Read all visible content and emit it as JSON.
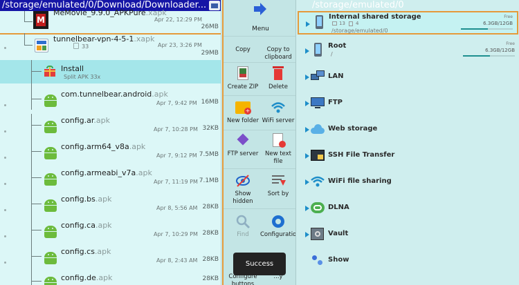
{
  "left": {
    "path": "/storage/emulated/0/Download/Downloader...",
    "top_item": {
      "name": "MeMovie_9.9.0_APKPure",
      "ext": ".xapk",
      "date": "Apr 22, 12:29 PM",
      "size": "26MB"
    },
    "folder": {
      "name": "tunnelbear-vpn-4-5-1",
      "ext": ".xapk",
      "count": "33",
      "date": "Apr 23, 3:26 PM",
      "size": "29MB"
    },
    "install": {
      "name": "Install",
      "sub": "Split APK 33x"
    },
    "files": [
      {
        "name": "com.tunnelbear.android",
        "ext": ".apk",
        "date": "Apr 7, 9:42 PM",
        "size": "16MB"
      },
      {
        "name": "config.ar",
        "ext": ".apk",
        "date": "Apr 7, 10:28 PM",
        "size": "32KB"
      },
      {
        "name": "config.arm64_v8a",
        "ext": ".apk",
        "date": "Apr 7, 9:12 PM",
        "size": "7.5MB"
      },
      {
        "name": "config.armeabi_v7a",
        "ext": ".apk",
        "date": "Apr 7, 11:19 PM",
        "size": "7.1MB"
      },
      {
        "name": "config.bs",
        "ext": ".apk",
        "date": "Apr 8, 5:56 AM",
        "size": "28KB"
      },
      {
        "name": "config.ca",
        "ext": ".apk",
        "date": "Apr 7, 10:29 PM",
        "size": "28KB"
      },
      {
        "name": "config.cs",
        "ext": ".apk",
        "date": "Apr 8, 2:43 AM",
        "size": "28KB"
      },
      {
        "name": "config.de",
        "ext": ".apk",
        "date": "",
        "size": "28KB"
      }
    ]
  },
  "menu": {
    "title": "Menu",
    "items": [
      {
        "label": "Copy"
      },
      {
        "label": "Copy to clipboard"
      },
      {
        "label": "Create ZIP"
      },
      {
        "label": "Delete"
      },
      {
        "label": "New folder"
      },
      {
        "label": "WiFi server"
      },
      {
        "label": "FTP server"
      },
      {
        "label": "New text file"
      },
      {
        "label": "Show hidden"
      },
      {
        "label": "Sort by"
      },
      {
        "label": "Find"
      },
      {
        "label": "Configuration"
      },
      {
        "label": "Configure buttons"
      },
      {
        "label": "...y"
      }
    ],
    "toast": "Success"
  },
  "right": {
    "path": "/storage/emulated/0",
    "storages": [
      {
        "name": "Internal shared storage",
        "path": "/storage/emulated/0",
        "folders": "13",
        "files": "4",
        "free": "Free",
        "size": "6.3GB/12GB",
        "used_fraction": 0.52
      },
      {
        "name": "Root",
        "path": "/",
        "free": "Free",
        "size": "6.3GB/12GB",
        "used_fraction": 0.52
      }
    ],
    "items": [
      {
        "label": "LAN",
        "icon": "lan-icon"
      },
      {
        "label": "FTP",
        "icon": "ftp-icon"
      },
      {
        "label": "Web storage",
        "icon": "cloud-icon"
      },
      {
        "label": "SSH File Transfer",
        "icon": "ssh-icon"
      },
      {
        "label": "WiFi file sharing",
        "icon": "wifi-icon"
      },
      {
        "label": "DLNA",
        "icon": "dlna-icon"
      },
      {
        "label": "Vault",
        "icon": "vault-icon"
      },
      {
        "label": "Show",
        "icon": "show-icon"
      }
    ]
  },
  "colors": {
    "path_bar": "#1515a6",
    "accent": "#e59a3a",
    "android": "#6cbb3c",
    "highlight": "#a4e6ea"
  }
}
